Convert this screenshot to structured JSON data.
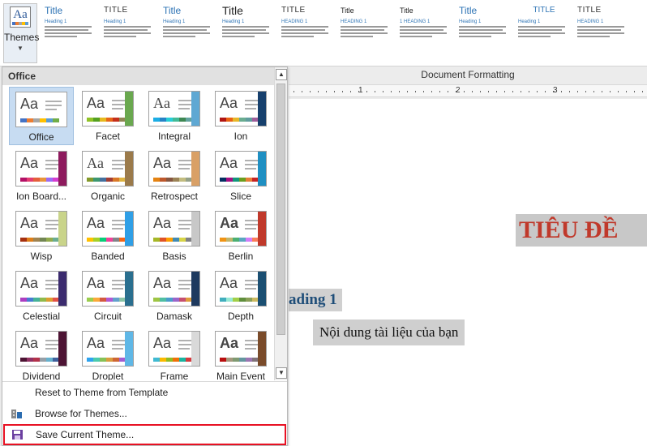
{
  "ribbon": {
    "themes_label": "Themes",
    "style_previews": [
      {
        "title": "Title",
        "heading": "Heading 1",
        "variant": ""
      },
      {
        "title": "TITLE",
        "heading": "Heading 1",
        "variant": "upper"
      },
      {
        "title": "Title",
        "heading": "Heading 1",
        "variant": ""
      },
      {
        "title": "Title",
        "heading": "Heading 1",
        "variant": "big"
      },
      {
        "title": "TITLE",
        "heading": "HEADING 1",
        "variant": "upper"
      },
      {
        "title": "Title",
        "heading": "HEADING 1",
        "variant": "small"
      },
      {
        "title": "Title",
        "heading": "1 HEADING 1",
        "variant": "small"
      },
      {
        "title": "Title",
        "heading": "Heading 1",
        "variant": ""
      },
      {
        "title": "TITLE",
        "heading": "Heading 1",
        "variant": "upper2"
      },
      {
        "title": "TITLE",
        "heading": "HEADING 1",
        "variant": "upper"
      }
    ]
  },
  "doc": {
    "group_label": "Document Formatting",
    "ruler_numbers": [
      "1",
      "2",
      "3"
    ],
    "title_text": "TIÊU ĐỀ",
    "heading_text": "ading 1",
    "body_text": "Nội dung tài liệu của bạn"
  },
  "panel": {
    "header": "Office",
    "themes": [
      {
        "name": "Office",
        "aa": "Aa",
        "palette": [
          "#4472c4",
          "#ed7d31",
          "#a5a5a5",
          "#ffc000",
          "#5b9bd5",
          "#70ad47"
        ],
        "deco": "",
        "font": ""
      },
      {
        "name": "Facet",
        "aa": "Aa",
        "palette": [
          "#90c226",
          "#54a021",
          "#e6b91e",
          "#e76618",
          "#c42f1a",
          "#918655"
        ],
        "deco": "#6aa84f",
        "font": ""
      },
      {
        "name": "Integral",
        "aa": "Aa",
        "palette": [
          "#1cade4",
          "#2683c6",
          "#27ced7",
          "#42ba97",
          "#3e8853",
          "#62a39f"
        ],
        "deco": "#5fa8d3",
        "font": "serif"
      },
      {
        "name": "Ion",
        "aa": "Aa",
        "palette": [
          "#b01513",
          "#ea6312",
          "#e6b729",
          "#6aac90",
          "#5f9c9d",
          "#9e5e9b"
        ],
        "deco": "#17406d",
        "font": ""
      },
      {
        "name": "Ion Board...",
        "aa": "Aa",
        "palette": [
          "#b31166",
          "#e33d6f",
          "#e45f3c",
          "#e9943a",
          "#9b6bf2",
          "#d53dd0"
        ],
        "deco": "#8e1b5e",
        "font": ""
      },
      {
        "name": "Organic",
        "aa": "Aa",
        "palette": [
          "#83992a",
          "#3c9770",
          "#44709d",
          "#a23c33",
          "#d97828",
          "#deb340"
        ],
        "deco": "#9b7a4a",
        "font": "serif"
      },
      {
        "name": "Retrospect",
        "aa": "Aa",
        "palette": [
          "#e48312",
          "#bd582c",
          "#865640",
          "#9b8357",
          "#c2bc80",
          "#94a088"
        ],
        "deco": "#d9a066",
        "font": ""
      },
      {
        "name": "Slice",
        "aa": "Aa",
        "palette": [
          "#052f61",
          "#a50e82",
          "#14967c",
          "#6a9e1f",
          "#e87d37",
          "#c62324"
        ],
        "deco": "#1f8fc2",
        "font": ""
      },
      {
        "name": "Wisp",
        "aa": "Aa",
        "palette": [
          "#a53010",
          "#de7e18",
          "#9f8351",
          "#728653",
          "#92aa4c",
          "#6aac91"
        ],
        "deco": "#c9d48a",
        "font": ""
      },
      {
        "name": "Banded",
        "aa": "Aa",
        "palette": [
          "#ffc000",
          "#a5d028",
          "#08cc78",
          "#f24099",
          "#828288",
          "#f56617"
        ],
        "deco": "#2f9fe6",
        "font": ""
      },
      {
        "name": "Basis",
        "aa": "Aa",
        "palette": [
          "#a6b727",
          "#df5327",
          "#fe9e00",
          "#418ab3",
          "#d7d447",
          "#818183"
        ],
        "deco": "#c8c8c8",
        "font": ""
      },
      {
        "name": "Berlin",
        "aa": "Aa",
        "palette": [
          "#f09415",
          "#c1b56b",
          "#4baf73",
          "#5aa6c0",
          "#d17df9",
          "#fa7e5c"
        ],
        "deco": "#c0392b",
        "font": "bold"
      },
      {
        "name": "Celestial",
        "aa": "Aa",
        "palette": [
          "#ac3ec1",
          "#477bd1",
          "#46b298",
          "#90ba4c",
          "#dd9d31",
          "#e25247"
        ],
        "deco": "#3b2b6e",
        "font": ""
      },
      {
        "name": "Circuit",
        "aa": "Aa",
        "palette": [
          "#9acd4c",
          "#faa93a",
          "#d35940",
          "#b258d3",
          "#63a0cc",
          "#8ac4a7"
        ],
        "deco": "#2a6f8f",
        "font": ""
      },
      {
        "name": "Damask",
        "aa": "Aa",
        "palette": [
          "#9ec544",
          "#50bea3",
          "#4a9ccc",
          "#9a66ca",
          "#c54f71",
          "#de9c3c"
        ],
        "deco": "#1e3a5f",
        "font": ""
      },
      {
        "name": "Depth",
        "aa": "Aa",
        "palette": [
          "#41aebd",
          "#97e9d5",
          "#a2cf49",
          "#608f3d",
          "#8a9f57",
          "#ccba61"
        ],
        "deco": "#1b4f72",
        "font": ""
      },
      {
        "name": "Dividend",
        "aa": "Aa",
        "palette": [
          "#4d1434",
          "#903163",
          "#b2324b",
          "#969fa7",
          "#66b1ce",
          "#40619d"
        ],
        "deco": "#4d1434",
        "font": ""
      },
      {
        "name": "Droplet",
        "aa": "Aa",
        "palette": [
          "#2fa3ee",
          "#4bcaad",
          "#86c157",
          "#d99c3f",
          "#ce6633",
          "#a35dd1"
        ],
        "deco": "#5fb7e6",
        "font": ""
      },
      {
        "name": "Frame",
        "aa": "Aa",
        "palette": [
          "#40bad2",
          "#fab900",
          "#90bb23",
          "#ee7008",
          "#1ab39f",
          "#d5393d"
        ],
        "deco": "#d9d9d9",
        "font": ""
      },
      {
        "name": "Main Event",
        "aa": "Aa",
        "palette": [
          "#b80e0f",
          "#a6987d",
          "#7f9a71",
          "#64969f",
          "#9b75b2",
          "#80737a"
        ],
        "deco": "#7a4b2a",
        "font": "bold"
      }
    ],
    "menu": {
      "reset": "Reset to Theme from Template",
      "browse": "Browse for Themes...",
      "save": "Save Current Theme..."
    }
  },
  "colors": {
    "selection": "#c7dcf2",
    "highlight_border": "#e81123",
    "title_red": "#c0392b",
    "heading_blue": "#1f4e79"
  }
}
